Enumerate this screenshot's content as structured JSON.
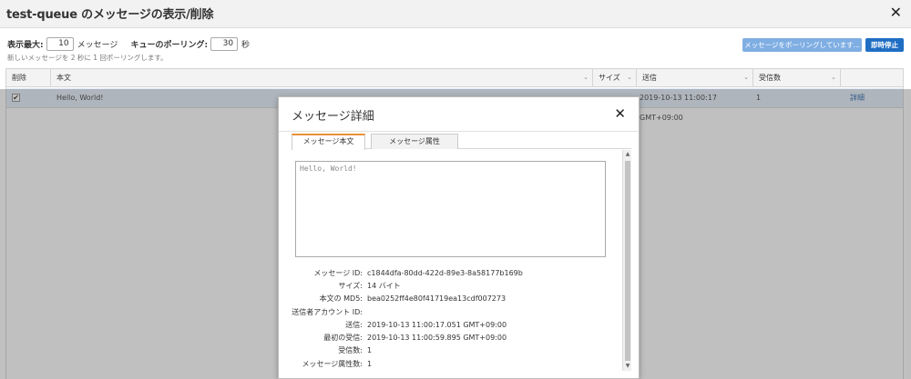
{
  "window": {
    "title": "test-queue のメッセージの表示/削除"
  },
  "controls": {
    "max_display_label": "表示最大:",
    "max_display_value": "10",
    "max_display_unit": "メッセージ",
    "poll_label": "キューのポーリング:",
    "poll_value": "30",
    "poll_unit": "秒",
    "note": "新しいメッセージを 2 秒に 1 回ポーリングします。"
  },
  "buttons": {
    "polling": "メッセージをポーリングしています...",
    "stop": "即時停止"
  },
  "table": {
    "columns": [
      "削除",
      "本文",
      "サイズ",
      "送信",
      "受信数"
    ],
    "rows": [
      {
        "delete_checked": "✔",
        "body": "Hello, World!",
        "sent": "2019-10-13 11:00:17 GMT+09:00",
        "receive_count": "1",
        "detail": "詳細"
      }
    ]
  },
  "modal": {
    "title": "メッセージ詳細",
    "tabs": [
      "メッセージ本文",
      "メッセージ属性"
    ],
    "active_tab": "メッセージ本文",
    "body": "Hello, World!",
    "attributes": [
      {
        "key": "メッセージ ID:",
        "value": "c1844dfa-80dd-422d-89e3-8a58177b169b"
      },
      {
        "key": "サイズ:",
        "value": "14 バイト"
      },
      {
        "key": "本文の MD5:",
        "value": "bea0252ff4e80f41719ea13cdf007273"
      },
      {
        "key": "送信者アカウント ID:",
        "value": ""
      },
      {
        "key": "送信:",
        "value": "2019-10-13 11:00:17.051 GMT+09:00"
      },
      {
        "key": "最初の受信:",
        "value": "2019-10-13 11:00:59.895 GMT+09:00"
      },
      {
        "key": "受信数:",
        "value": "1"
      },
      {
        "key": "メッセージ属性数:",
        "value": "1"
      }
    ]
  },
  "icons": {
    "close": "close-icon",
    "sort_caret": "sort-caret-icon",
    "checkbox": "checkbox-icon"
  }
}
